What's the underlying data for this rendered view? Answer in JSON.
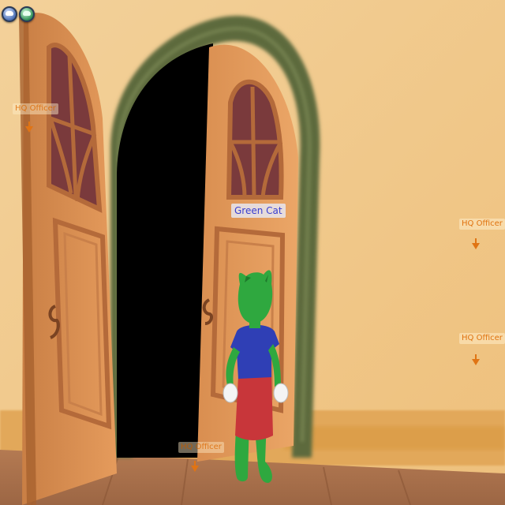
{
  "hud": {
    "friends_button_icon": "toon-head-icon",
    "menu_button_icon": "toon-head-icon"
  },
  "player": {
    "name": "Green Cat"
  },
  "npc_tags": [
    {
      "label": "HQ Officer"
    },
    {
      "label": "HQ Officer"
    },
    {
      "label": "HQ Officer"
    },
    {
      "label": "HQ Officer"
    }
  ],
  "colors": {
    "wall": "#f0c98a",
    "door": "#e09a5c",
    "door_frame": "#5d6b3e",
    "floor": "#b87c55",
    "npc_label": "#e0730f",
    "player_label": "#3a3fd0",
    "player_body": "#2fa83f",
    "player_shirt": "#2f3fb5",
    "player_skirt": "#c8363a"
  }
}
